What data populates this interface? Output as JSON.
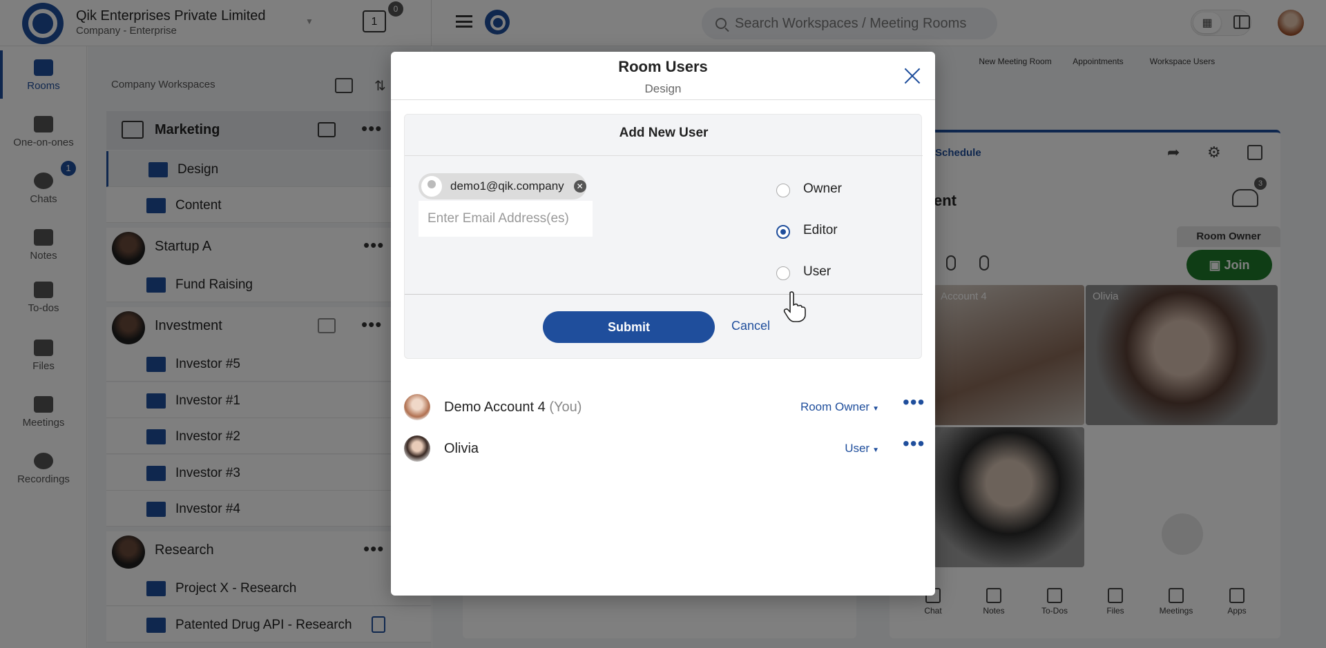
{
  "topbar": {
    "company_name": "Qik Enterprises Private Limited",
    "company_sub": "Company - Enterprise",
    "calendar_day": "1",
    "calendar_badge": "0",
    "search_placeholder": "Search Workspaces / Meeting Rooms"
  },
  "leftnav": {
    "items": [
      {
        "label": "Rooms"
      },
      {
        "label": "One-on-ones"
      },
      {
        "label": "Chats"
      },
      {
        "label": "Notes"
      },
      {
        "label": "To-dos"
      },
      {
        "label": "Files"
      },
      {
        "label": "Meetings"
      },
      {
        "label": "Recordings"
      }
    ],
    "chats_badge": "1"
  },
  "workspaces": {
    "title": "Company Workspaces",
    "groups": [
      {
        "name": "Marketing",
        "rooms": [
          "Design",
          "Content"
        ]
      },
      {
        "name": "Startup A",
        "rooms": [
          "Fund Raising"
        ]
      },
      {
        "name": "Investment",
        "rooms": [
          "Investor #5",
          "Investor #1",
          "Investor #2",
          "Investor #3",
          "Investor #4"
        ]
      },
      {
        "name": "Research",
        "rooms": [
          "Project X - Research",
          "Patented Drug API - Research"
        ]
      }
    ]
  },
  "background": {
    "toolbar": [
      "New Meeting Room",
      "Appointments",
      "Workspace Users"
    ],
    "schedule_link": "Schedule",
    "room_title_fragment": "ent",
    "users_badge": "3",
    "room_owner_label": "Room Owner",
    "join_label": "Join",
    "tiles": [
      "Account 4",
      "Olivia"
    ],
    "bottom_bar": [
      "Chat",
      "Notes",
      "To-Dos",
      "Files",
      "Meetings",
      "Apps"
    ]
  },
  "modal": {
    "title": "Room Users",
    "subtitle": "Design",
    "add_title": "Add New User",
    "chip_email": "demo1@qik.company",
    "email_placeholder": "Enter Email Address(es)",
    "roles": [
      "Owner",
      "Editor",
      "User"
    ],
    "selected_role": "Editor",
    "submit_label": "Submit",
    "cancel_label": "Cancel",
    "users": [
      {
        "name": "Demo Account 4",
        "suffix": "(You)",
        "role": "Room Owner"
      },
      {
        "name": "Olivia",
        "suffix": "",
        "role": "User"
      }
    ]
  },
  "colors": {
    "accent": "#1f4e9c",
    "join": "#1e7a2a"
  }
}
